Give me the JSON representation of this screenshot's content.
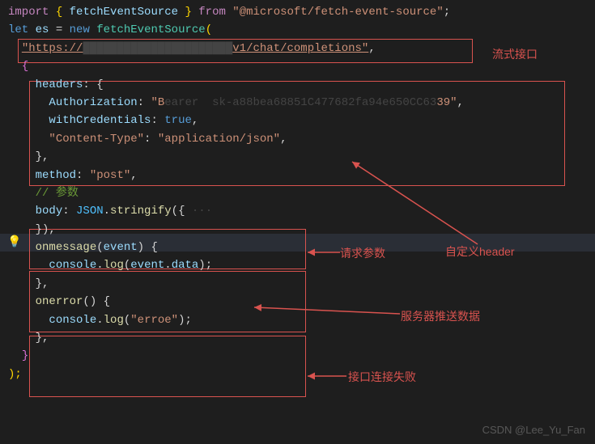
{
  "code": {
    "l1_import": "import",
    "l1_ob": " { ",
    "l1_fes": "fetchEventSource",
    "l1_cb": " } ",
    "l1_from": "from",
    "l1_pkg": "\"@microsoft/fetch-event-source\"",
    "l1_semi": ";",
    "l2_let": "let",
    "l2_es": " es ",
    "l2_eq": "= ",
    "l2_new": "new",
    "l2_fes": " fetchEventSource",
    "l2_paren": "(",
    "l3_url_a": "\"https://",
    "l3_url_mid_hidden": "██████████████████████",
    "l3_url_b": "v1/chat/completions\"",
    "l3_comma": ",",
    "l4_brace": "{",
    "l5_headers": "headers",
    "l5_colon_brace": ": {",
    "l6_auth": "Authorization",
    "l6_colon": ": ",
    "l6_val_a": "\"B",
    "l6_val_hidden": "earer  sk-a88bea68851C477682fa94e650CC63",
    "l6_val_b": "39\"",
    "l6_comma": ",",
    "l7_wc": "withCredentials",
    "l7_colon": ": ",
    "l7_true": "true",
    "l7_comma": ",",
    "l8_ct": "\"Content-Type\"",
    "l8_colon": ": ",
    "l8_val": "\"application/json\"",
    "l8_comma": ",",
    "l9_cb": "},",
    "l10_method": "method",
    "l10_colon": ": ",
    "l10_val": "\"post\"",
    "l10_comma": ",",
    "l11_comment": "// 参数",
    "l12_body": "body",
    "l12_colon": ": ",
    "l12_json": "JSON",
    "l12_dot": ".",
    "l12_stringify": "stringify",
    "l12_paren_brace": "({",
    "l12_ellipsis": " ···",
    "l13_close": "}),",
    "l14_onmsg": "onmessage",
    "l14_paren": "(",
    "l14_event": "event",
    "l14_pc_brace": ") {",
    "l15_console": "console",
    "l15_dot": ".",
    "l15_log": "log",
    "l15_paren": "(",
    "l15_ev": "event",
    "l15_dot2": ".",
    "l15_data": "data",
    "l15_close": ");",
    "l16_cb": "},",
    "l17_onerr": "onerror",
    "l17_paren": "() {",
    "l18_console": "console",
    "l18_dot": ".",
    "l18_log": "log",
    "l18_paren": "(",
    "l18_val": "\"erroe\"",
    "l18_close": ");",
    "l19_cb": "},",
    "l20_cb": "}",
    "l21_close": ");"
  },
  "annotations": {
    "stream_api": "流式接口",
    "custom_header": "自定义header",
    "request_params": "请求参数",
    "server_push": "服务器推送数据",
    "conn_fail": "接口连接失败"
  },
  "watermark": "CSDN @Lee_Yu_Fan"
}
